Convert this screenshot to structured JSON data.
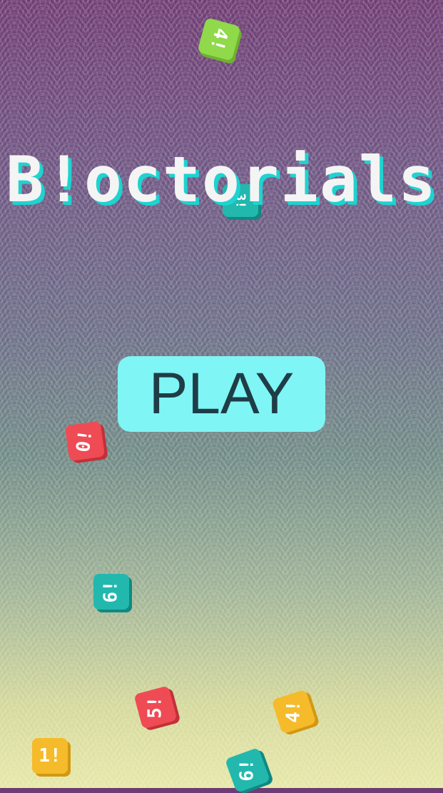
{
  "game": {
    "title": "B!octorials",
    "play_label": "PLAY"
  },
  "tiles": [
    {
      "label": "4!",
      "color": "#8fd94a"
    },
    {
      "label": "3!",
      "color": "#22b8ae"
    },
    {
      "label": "0!",
      "color": "#ef4b55"
    },
    {
      "label": "6!",
      "color": "#22b8ae"
    },
    {
      "label": "5!",
      "color": "#ef4b55"
    },
    {
      "label": "4!",
      "color": "#f5bb2a"
    },
    {
      "label": "1!",
      "color": "#f5bb2a"
    },
    {
      "label": "6!",
      "color": "#22b8ae"
    }
  ],
  "colors": {
    "accent": "#7ff5f5",
    "title_shadow": "#1ed3d0"
  }
}
